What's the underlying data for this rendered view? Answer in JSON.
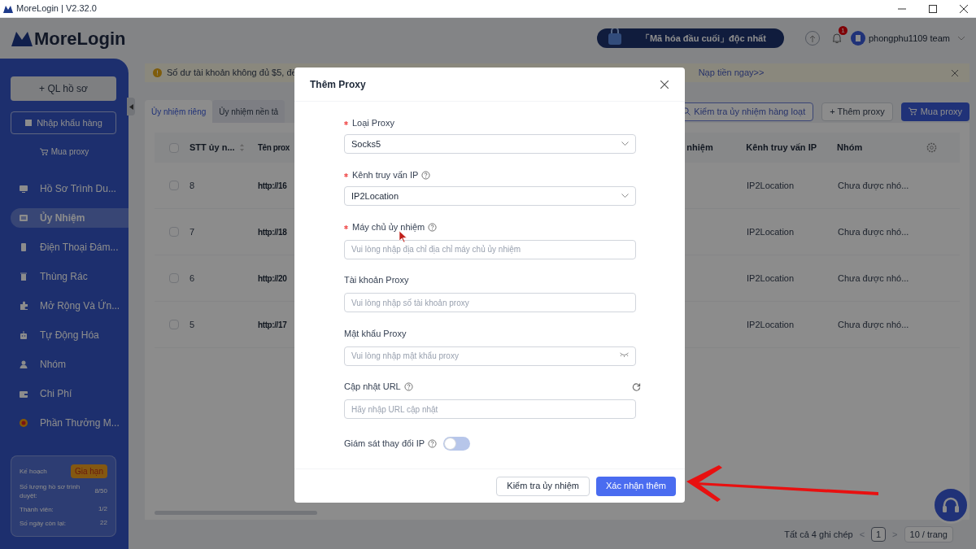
{
  "window": {
    "title": "MoreLogin | V2.32.0"
  },
  "header": {
    "logo": "MoreLogin",
    "promo": "「Mã hóa đầu cuối」độc nhất",
    "notification_count": "1",
    "user": "phongphu1109 team"
  },
  "sidebar": {
    "create_button": "+ QL hồ sơ",
    "import_button": "Nhập khẩu hàng",
    "buy_link": "Mua proxy",
    "items": [
      {
        "label": "Hồ Sơ Trình Du...",
        "selected": false
      },
      {
        "label": "Ủy Nhiệm",
        "selected": true
      },
      {
        "label": "Điện Thoại Đám...",
        "selected": false
      },
      {
        "label": "Thùng Rác",
        "selected": false
      },
      {
        "label": "Mở Rộng Và Ứn...",
        "selected": false
      },
      {
        "label": "Tự Động Hóa",
        "selected": false
      },
      {
        "label": "Nhóm",
        "selected": false
      },
      {
        "label": "Chi Phí",
        "selected": false
      },
      {
        "label": "Phần Thưởng M...",
        "selected": false
      }
    ],
    "plan": {
      "label": "Kế hoạch",
      "renew": "Gia hạn",
      "stats": [
        {
          "label": "Số lượng hồ sơ trình duyệt:",
          "value": "8/50"
        },
        {
          "label": "Thành viên:",
          "value": "1/2"
        },
        {
          "label": "Số ngày còn lại:",
          "value": "22"
        }
      ]
    }
  },
  "notice": {
    "text": "Số dư tài khoản không đủ $5, đế",
    "link": "Nạp tiền ngay>>"
  },
  "tabs": [
    {
      "label": "Ủy nhiệm riêng",
      "selected": true
    },
    {
      "label": "Ủy nhiệm nền tả",
      "selected": false
    }
  ],
  "toolbar": [
    {
      "label": "Kiểm tra ủy nhiệm hàng loạt",
      "kind": "check"
    },
    {
      "label": "+ Thêm proxy",
      "kind": "add"
    },
    {
      "label": "Mua proxy",
      "kind": "buy"
    }
  ],
  "table": {
    "select_all_checked": false,
    "columns": [
      "STT ủy n...",
      "Tên prox",
      "nhiệm",
      "Kênh truy vấn IP",
      "Nhóm"
    ],
    "rows": [
      {
        "checked": false,
        "stt": "8",
        "name": "http://16",
        "channel": "IP2Location",
        "group": "Chưa được nhó..."
      },
      {
        "checked": false,
        "stt": "7",
        "name": "http://18",
        "channel": "IP2Location",
        "group": "Chưa được nhó..."
      },
      {
        "checked": false,
        "stt": "6",
        "name": "http://20",
        "channel": "IP2Location",
        "group": "Chưa được nhó..."
      },
      {
        "checked": false,
        "stt": "5",
        "name": "http://17",
        "channel": "IP2Location",
        "group": "Chưa được nhó..."
      }
    ]
  },
  "pagination": {
    "total": "Tất cả 4 ghi chép",
    "prev": "<",
    "page": "1",
    "next": ">",
    "page_size": "10 / trang"
  },
  "dialog": {
    "title": "Thêm Proxy",
    "fields": [
      {
        "label": "Loại Proxy",
        "required": true,
        "help": false,
        "kind": "select",
        "value": "Socks5"
      },
      {
        "label": "Kênh truy vấn IP",
        "required": true,
        "help": true,
        "kind": "select",
        "value": "IP2Location"
      },
      {
        "label": "Máy chủ ủy nhiệm",
        "required": true,
        "help": true,
        "kind": "input",
        "placeholder": "Vui lòng nhập địa chỉ địa chỉ máy chủ ủy nhiệm"
      },
      {
        "label": "Tài khoản Proxy",
        "required": false,
        "help": false,
        "kind": "input",
        "placeholder": "Vui lòng nhập số tài khoản proxy"
      },
      {
        "label": "Mật khẩu Proxy",
        "required": false,
        "help": false,
        "kind": "password",
        "placeholder": "Vui lòng nhập mật khẩu proxy"
      },
      {
        "label": "Cập nhật URL",
        "required": false,
        "help": true,
        "kind": "url",
        "placeholder": "Hãy nhập URL cập nhật"
      }
    ],
    "toggle": {
      "label": "Giám sát thay đổi IP",
      "help": true,
      "on": false
    },
    "buttons": [
      {
        "label": "Kiểm tra ủy nhiệm",
        "primary": false
      },
      {
        "label": "Xác nhận thêm",
        "primary": true
      }
    ]
  }
}
